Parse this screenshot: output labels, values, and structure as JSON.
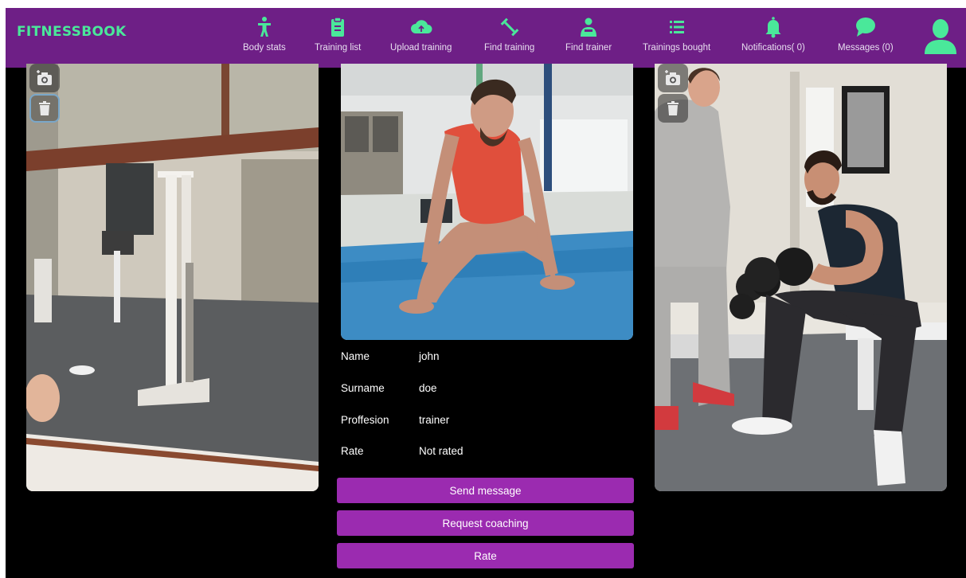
{
  "brand": {
    "name": "FITNESSBOOK",
    "color": "#4ae89a"
  },
  "nav": {
    "items": [
      {
        "label": "Body stats",
        "icon": "body-icon"
      },
      {
        "label": "Training list",
        "icon": "clipboard-icon"
      },
      {
        "label": "Upload training",
        "icon": "cloud-upload-icon"
      },
      {
        "label": "Find training",
        "icon": "dumbbell-icon"
      },
      {
        "label": "Find trainer",
        "icon": "trainer-icon"
      },
      {
        "label": "Trainings bought",
        "icon": "list-icon"
      },
      {
        "label": "Notifications( 0)",
        "icon": "bell-icon"
      },
      {
        "label": "Messages (0)",
        "icon": "chat-bubble-icon"
      }
    ],
    "user_icon": "user-avatar-icon",
    "background": "#6e1f86"
  },
  "panels": {
    "left": {
      "tools": [
        "camera-add-icon",
        "trash-icon"
      ]
    },
    "right": {
      "tools": [
        "camera-add-icon",
        "trash-icon"
      ]
    }
  },
  "profile": {
    "fields": [
      {
        "label": "Name",
        "value": "john"
      },
      {
        "label": "Surname",
        "value": "doe"
      },
      {
        "label": "Proffesion",
        "value": "trainer"
      },
      {
        "label": "Rate",
        "value": "Not rated"
      }
    ]
  },
  "actions": {
    "send_message": "Send message",
    "request_coaching": "Request coaching",
    "rate": "Rate",
    "color": "#9b2bb0"
  }
}
